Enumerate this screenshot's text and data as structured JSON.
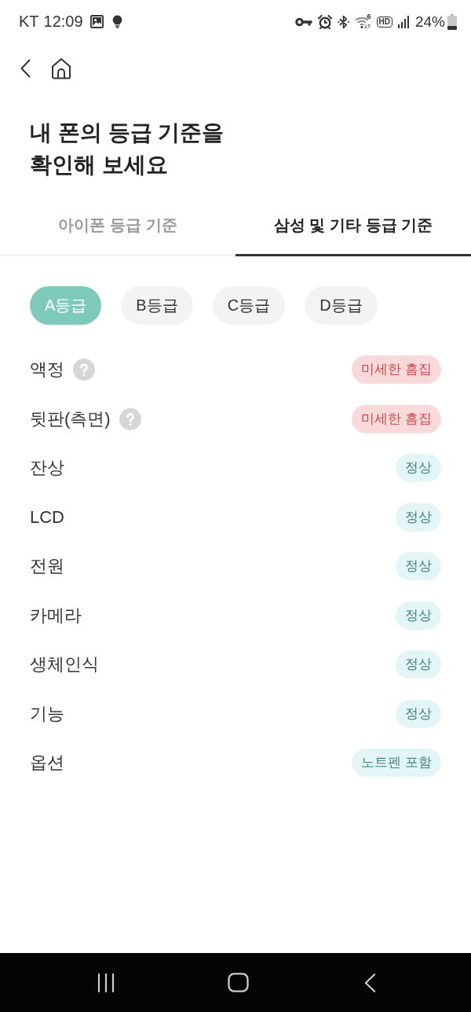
{
  "status_bar": {
    "carrier": "KT",
    "time": "12:09",
    "wifi_badge": "6",
    "hd_label": "HD",
    "battery": "24%"
  },
  "title": "내 폰의 등급 기준을\n확인해 보세요",
  "tabs": [
    {
      "label": "아이폰 등급 기준",
      "selected": false
    },
    {
      "label": "삼성 및 기타 등급 기준",
      "selected": true
    }
  ],
  "grades": [
    {
      "label": "A등급",
      "selected": true
    },
    {
      "label": "B등급",
      "selected": false
    },
    {
      "label": "C등급",
      "selected": false
    },
    {
      "label": "D등급",
      "selected": false
    }
  ],
  "criteria": [
    {
      "name": "액정",
      "help": true,
      "kind": "defect",
      "value": "미세한 흠집"
    },
    {
      "name": "뒷판(측면)",
      "help": true,
      "kind": "defect",
      "value": "미세한 흠집"
    },
    {
      "name": "잔상",
      "help": false,
      "kind": "normal",
      "value": "정상"
    },
    {
      "name": "LCD",
      "help": false,
      "kind": "normal",
      "value": "정상"
    },
    {
      "name": "전원",
      "help": false,
      "kind": "normal",
      "value": "정상"
    },
    {
      "name": "카메라",
      "help": false,
      "kind": "normal",
      "value": "정상"
    },
    {
      "name": "생체인식",
      "help": false,
      "kind": "normal",
      "value": "정상"
    },
    {
      "name": "기능",
      "help": false,
      "kind": "normal",
      "value": "정상"
    },
    {
      "name": "옵션",
      "help": false,
      "kind": "normal",
      "value": "노트펜 포함"
    }
  ]
}
